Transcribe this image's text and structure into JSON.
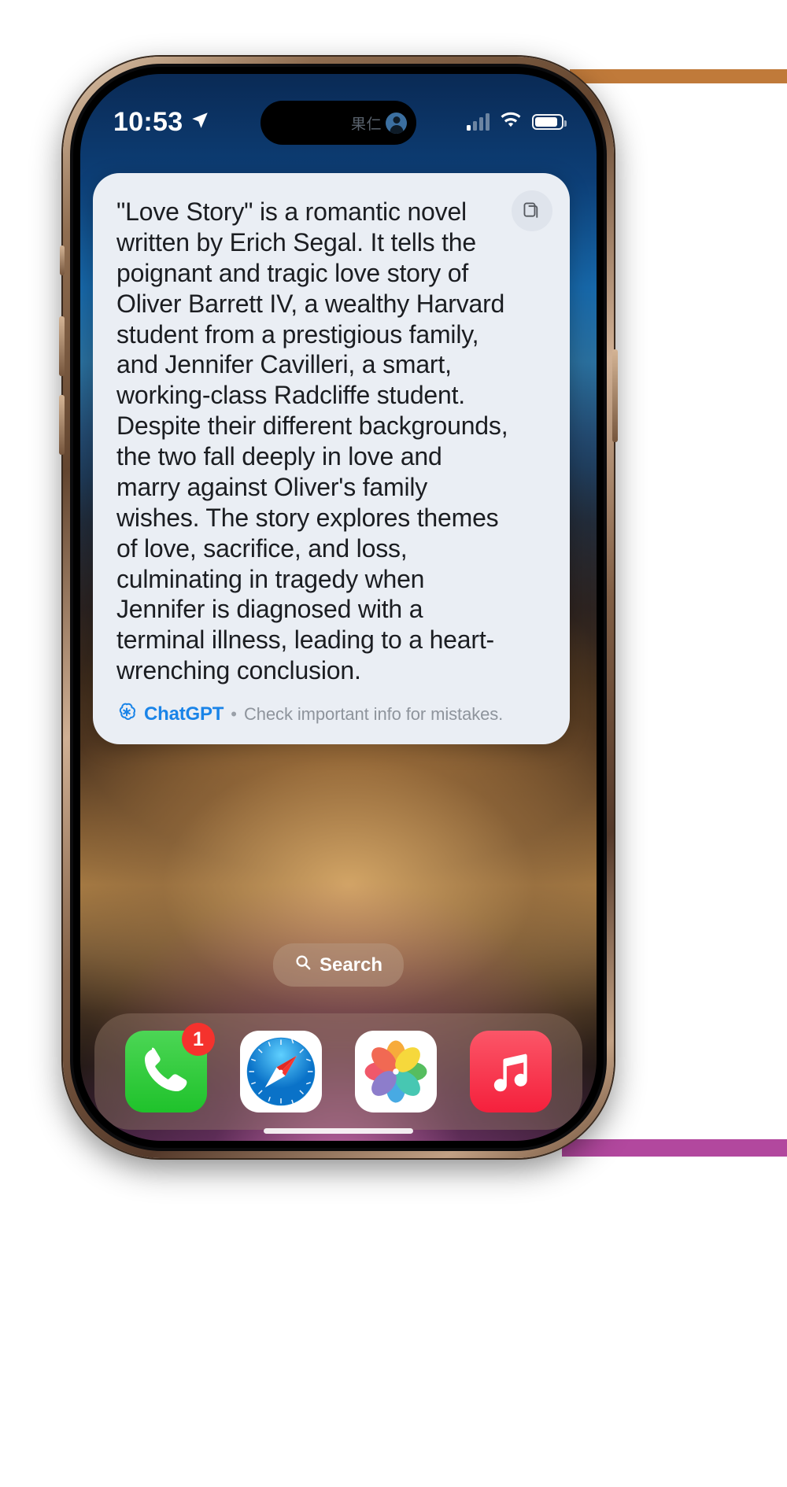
{
  "status_bar": {
    "time": "10:53",
    "location_icon": "location-arrow-icon",
    "signal_icon": "cellular-signal-icon",
    "wifi_icon": "wifi-icon",
    "battery_icon": "battery-icon"
  },
  "dynamic_island": {
    "label": "果仁",
    "avatar_icon": "person-circle-icon"
  },
  "card": {
    "copy_icon": "copy-documents-icon",
    "body": "\"Love Story\" is a romantic novel written by Erich Segal. It tells the poignant and tragic love story of Oliver Barrett IV, a wealthy Harvard student from a prestigious family, and Jennifer Cavilleri, a smart, working-class Radcliffe student. Despite their different backgrounds, the two fall deeply in love and marry against Oliver's family wishes. The story explores themes of love, sacrifice, and loss, culminating in tragedy when Jennifer is diagnosed with a terminal illness, leading to a heart-wrenching conclusion.",
    "footer": {
      "logo_icon": "chatgpt-logo-icon",
      "provider": "ChatGPT",
      "separator": "•",
      "disclaimer": "Check important info for mistakes."
    }
  },
  "search": {
    "icon": "search-icon",
    "label": "Search"
  },
  "dock": {
    "apps": [
      {
        "name": "Phone",
        "icon": "phone-icon",
        "badge": "1"
      },
      {
        "name": "Safari",
        "icon": "safari-compass-icon",
        "badge": ""
      },
      {
        "name": "Photos",
        "icon": "photos-flower-icon",
        "badge": ""
      },
      {
        "name": "Music",
        "icon": "music-note-icon",
        "badge": ""
      }
    ]
  },
  "colors": {
    "card_bg": "#eaeef4",
    "chatgpt_blue": "#1a84e8",
    "badge_red": "#f5322d",
    "phone_green": "#23c92f",
    "music_red": "#f5203c"
  }
}
